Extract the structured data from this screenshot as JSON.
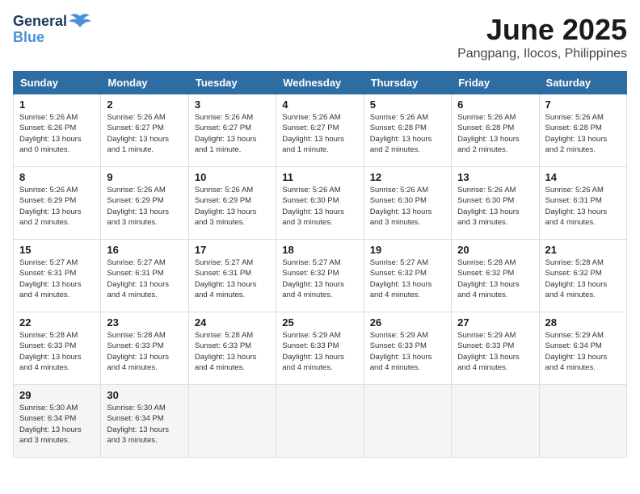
{
  "header": {
    "logo_line1": "General",
    "logo_line2": "Blue",
    "month_title": "June 2025",
    "location": "Pangpang, Ilocos, Philippines"
  },
  "weekdays": [
    "Sunday",
    "Monday",
    "Tuesday",
    "Wednesday",
    "Thursday",
    "Friday",
    "Saturday"
  ],
  "weeks": [
    [
      {
        "day": "1",
        "sunrise": "5:26 AM",
        "sunset": "6:26 PM",
        "daylight": "13 hours and 0 minutes."
      },
      {
        "day": "2",
        "sunrise": "5:26 AM",
        "sunset": "6:27 PM",
        "daylight": "13 hours and 1 minute."
      },
      {
        "day": "3",
        "sunrise": "5:26 AM",
        "sunset": "6:27 PM",
        "daylight": "13 hours and 1 minute."
      },
      {
        "day": "4",
        "sunrise": "5:26 AM",
        "sunset": "6:27 PM",
        "daylight": "13 hours and 1 minute."
      },
      {
        "day": "5",
        "sunrise": "5:26 AM",
        "sunset": "6:28 PM",
        "daylight": "13 hours and 2 minutes."
      },
      {
        "day": "6",
        "sunrise": "5:26 AM",
        "sunset": "6:28 PM",
        "daylight": "13 hours and 2 minutes."
      },
      {
        "day": "7",
        "sunrise": "5:26 AM",
        "sunset": "6:28 PM",
        "daylight": "13 hours and 2 minutes."
      }
    ],
    [
      {
        "day": "8",
        "sunrise": "5:26 AM",
        "sunset": "6:29 PM",
        "daylight": "13 hours and 2 minutes."
      },
      {
        "day": "9",
        "sunrise": "5:26 AM",
        "sunset": "6:29 PM",
        "daylight": "13 hours and 3 minutes."
      },
      {
        "day": "10",
        "sunrise": "5:26 AM",
        "sunset": "6:29 PM",
        "daylight": "13 hours and 3 minutes."
      },
      {
        "day": "11",
        "sunrise": "5:26 AM",
        "sunset": "6:30 PM",
        "daylight": "13 hours and 3 minutes."
      },
      {
        "day": "12",
        "sunrise": "5:26 AM",
        "sunset": "6:30 PM",
        "daylight": "13 hours and 3 minutes."
      },
      {
        "day": "13",
        "sunrise": "5:26 AM",
        "sunset": "6:30 PM",
        "daylight": "13 hours and 3 minutes."
      },
      {
        "day": "14",
        "sunrise": "5:26 AM",
        "sunset": "6:31 PM",
        "daylight": "13 hours and 4 minutes."
      }
    ],
    [
      {
        "day": "15",
        "sunrise": "5:27 AM",
        "sunset": "6:31 PM",
        "daylight": "13 hours and 4 minutes."
      },
      {
        "day": "16",
        "sunrise": "5:27 AM",
        "sunset": "6:31 PM",
        "daylight": "13 hours and 4 minutes."
      },
      {
        "day": "17",
        "sunrise": "5:27 AM",
        "sunset": "6:31 PM",
        "daylight": "13 hours and 4 minutes."
      },
      {
        "day": "18",
        "sunrise": "5:27 AM",
        "sunset": "6:32 PM",
        "daylight": "13 hours and 4 minutes."
      },
      {
        "day": "19",
        "sunrise": "5:27 AM",
        "sunset": "6:32 PM",
        "daylight": "13 hours and 4 minutes."
      },
      {
        "day": "20",
        "sunrise": "5:28 AM",
        "sunset": "6:32 PM",
        "daylight": "13 hours and 4 minutes."
      },
      {
        "day": "21",
        "sunrise": "5:28 AM",
        "sunset": "6:32 PM",
        "daylight": "13 hours and 4 minutes."
      }
    ],
    [
      {
        "day": "22",
        "sunrise": "5:28 AM",
        "sunset": "6:33 PM",
        "daylight": "13 hours and 4 minutes."
      },
      {
        "day": "23",
        "sunrise": "5:28 AM",
        "sunset": "6:33 PM",
        "daylight": "13 hours and 4 minutes."
      },
      {
        "day": "24",
        "sunrise": "5:28 AM",
        "sunset": "6:33 PM",
        "daylight": "13 hours and 4 minutes."
      },
      {
        "day": "25",
        "sunrise": "5:29 AM",
        "sunset": "6:33 PM",
        "daylight": "13 hours and 4 minutes."
      },
      {
        "day": "26",
        "sunrise": "5:29 AM",
        "sunset": "6:33 PM",
        "daylight": "13 hours and 4 minutes."
      },
      {
        "day": "27",
        "sunrise": "5:29 AM",
        "sunset": "6:33 PM",
        "daylight": "13 hours and 4 minutes."
      },
      {
        "day": "28",
        "sunrise": "5:29 AM",
        "sunset": "6:34 PM",
        "daylight": "13 hours and 4 minutes."
      }
    ],
    [
      {
        "day": "29",
        "sunrise": "5:30 AM",
        "sunset": "6:34 PM",
        "daylight": "13 hours and 3 minutes."
      },
      {
        "day": "30",
        "sunrise": "5:30 AM",
        "sunset": "6:34 PM",
        "daylight": "13 hours and 3 minutes."
      },
      null,
      null,
      null,
      null,
      null
    ]
  ]
}
